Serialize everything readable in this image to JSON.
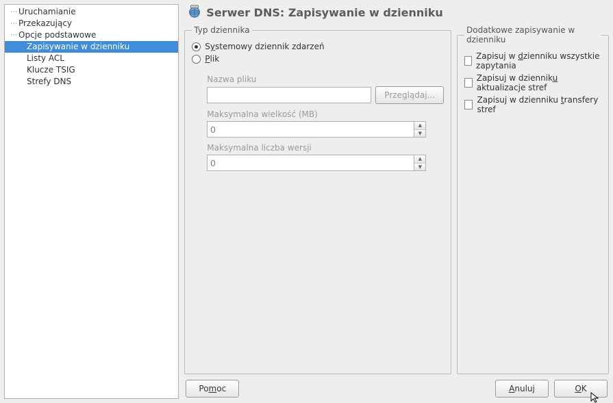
{
  "sidebar": {
    "items": [
      {
        "label": "Uruchamianie"
      },
      {
        "label": "Przekazujący"
      },
      {
        "label": "Opcje podstawowe"
      },
      {
        "label": "Zapisywanie w dzienniku",
        "selected": true
      },
      {
        "label": "Listy ACL"
      },
      {
        "label": "Klucze TSIG"
      },
      {
        "label": "Strefy DNS"
      }
    ]
  },
  "header": {
    "title": "Serwer DNS: Zapisywanie w dzienniku"
  },
  "logType": {
    "legend": "Typ dziennika",
    "system": {
      "prefix": "S",
      "accel": "y",
      "suffix": "stemowy dziennik zdarzeń"
    },
    "file": {
      "prefix": "",
      "accel": "P",
      "suffix": "lik"
    },
    "fileName": {
      "label": "Nazwa pliku",
      "value": ""
    },
    "browse": {
      "prefix": "Prze",
      "accel": "g",
      "suffix": "lądaj..."
    },
    "maxSize": {
      "label": "Maksymalna wielkość (MB)",
      "value": "0"
    },
    "maxVersions": {
      "label": "Maksymalna liczba wersji",
      "value": "0"
    }
  },
  "additional": {
    "legend": "Dodatkowe zapisywanie w dzienniku",
    "logQueries": {
      "prefix": "Zapisuj w ",
      "accel": "d",
      "suffix": "zienniku wszystkie zapytania"
    },
    "logUpdates": {
      "prefix": "Zapisuj w dziennik",
      "accel": "u",
      "suffix": " aktualizacje stref"
    },
    "logTransfers": {
      "prefix": "Zapisuj w dzienniku ",
      "accel": "t",
      "suffix": "ransfery stref"
    }
  },
  "footer": {
    "help": {
      "prefix": "Po",
      "accel": "m",
      "suffix": "oc"
    },
    "cancel": {
      "prefix": "",
      "accel": "A",
      "suffix": "nuluj"
    },
    "ok": {
      "prefix": "",
      "accel": "O",
      "suffix": "K"
    }
  }
}
